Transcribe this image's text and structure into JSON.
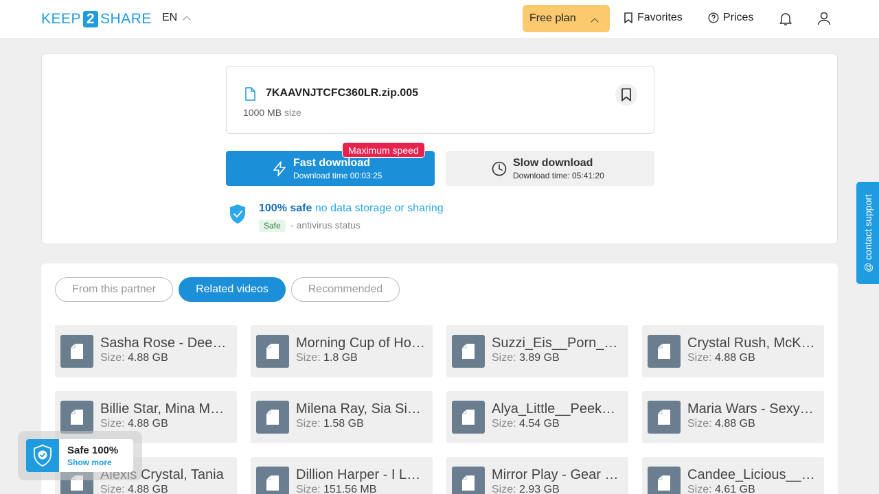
{
  "header": {
    "logo_left": "KEEP",
    "logo_mid": "2",
    "logo_right": "SHARE",
    "language": "EN",
    "plan_label": "Free plan",
    "favorites_label": "Favorites",
    "prices_label": "Prices"
  },
  "file": {
    "name": "7KAAVNJTCFC360LR.zip.005",
    "size_value": "1000 MB",
    "size_label": "size"
  },
  "download": {
    "fast_title": "Fast download",
    "fast_sub": "Download time 00:03:25",
    "max_badge": "Maximum speed",
    "slow_title": "Slow download",
    "slow_sub": "Download time: 05:41:20"
  },
  "safety": {
    "strong": "100% safe",
    "light": "no data storage or sharing",
    "tag": "Safe",
    "status": "- antivirus status"
  },
  "tabs": [
    "From this partner",
    "Related videos",
    "Recommended"
  ],
  "size_prefix": "Size:",
  "cards": [
    {
      "title": "Sasha Rose - Deep Throat",
      "size": "4.88 GB"
    },
    {
      "title": "Morning Cup of Honey",
      "size": "1.8 GB"
    },
    {
      "title": "Suzzi_Eis__Porn_Video",
      "size": "3.89 GB"
    },
    {
      "title": "Crystal Rush, McKenzie",
      "size": "4.88 GB"
    },
    {
      "title": "Billie Star, Mina Moon",
      "size": "4.88 GB"
    },
    {
      "title": "Milena Ray, Sia Siberia",
      "size": "1.58 GB"
    },
    {
      "title": "Alya_Little__Peek_Show",
      "size": "4.54 GB"
    },
    {
      "title": "Maria Wars - Sexy Girl",
      "size": "4.88 GB"
    },
    {
      "title": "Alexis Crystal, Tania",
      "size": "4.88 GB"
    },
    {
      "title": "Dillion Harper - I Love",
      "size": "151.56 MB"
    },
    {
      "title": "Mirror Play - Gear Up",
      "size": "2.93 GB"
    },
    {
      "title": "Candee_Licious__Video",
      "size": "4.61 GB"
    }
  ],
  "support_label": "@ contact support",
  "safe_widget": {
    "title": "Safe 100%",
    "link": "Show more"
  },
  "colors": {
    "brand": "#1f9be0",
    "fast_button": "#1b8fd7",
    "plan_button": "#fbc96e",
    "badge": "#e7224f"
  }
}
